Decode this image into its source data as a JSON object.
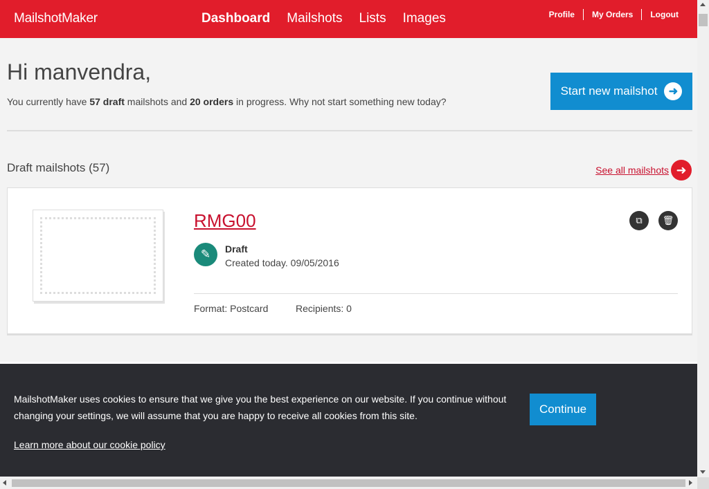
{
  "header": {
    "logo": "MailshotMaker",
    "nav": [
      {
        "label": "Dashboard",
        "active": true
      },
      {
        "label": "Mailshots",
        "active": false
      },
      {
        "label": "Lists",
        "active": false
      },
      {
        "label": "Images",
        "active": false
      }
    ],
    "top_links": {
      "profile": "Profile",
      "orders": "My Orders",
      "logout": "Logout"
    }
  },
  "welcome": {
    "greeting": "Hi manvendra,",
    "summary_prefix": "You currently have ",
    "draft_count": "57 draft",
    "summary_mid": " mailshots and ",
    "order_count": "20 orders",
    "summary_suffix": " in progress. Why not start something new today?",
    "start_button": "Start new mailshot"
  },
  "drafts": {
    "title": "Draft mailshots (57)",
    "see_all": "See all mailshots",
    "items": [
      {
        "name": "RMG00",
        "status": "Draft",
        "created": "Created today. 09/05/2016",
        "format": "Format: Postcard",
        "recipients": "Recipients: 0"
      }
    ]
  },
  "cookie_banner": {
    "text": "MailshotMaker uses cookies to ensure that we give you the best experience on our website. If you continue without changing your settings, we will assume that you are happy to receive all cookies from this site.",
    "link": "Learn more about our cookie policy",
    "button": "Continue"
  },
  "colors": {
    "brand_red": "#e11d2b",
    "primary_blue": "#118dd0",
    "status_teal": "#1a8a7a",
    "banner_dark": "#2b2c31"
  },
  "icons": [
    "arrow-right-icon",
    "pencil-icon",
    "copy-icon",
    "trash-icon"
  ]
}
